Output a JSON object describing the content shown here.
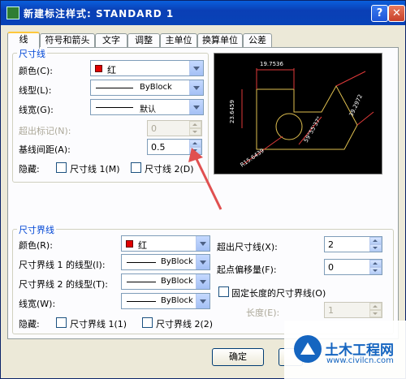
{
  "window": {
    "title": "新建标注样式: STANDARD 1",
    "help": "?",
    "close": "✕"
  },
  "tabs": [
    "线",
    "符号和箭头",
    "文字",
    "调整",
    "主单位",
    "换算单位",
    "公差"
  ],
  "dim_lines": {
    "group_title": "尺寸线",
    "color_label": "颜色(C):",
    "color_value": "红",
    "linetype_label": "线型(L):",
    "linetype_value": "ByBlock",
    "lineweight_label": "线宽(G):",
    "lineweight_value": "默认",
    "extend_label": "超出标记(N):",
    "extend_value": "0",
    "baseline_label": "基线间距(A):",
    "baseline_value": "0.5",
    "suppress_label": "隐藏:",
    "suppress_1": "尺寸线 1(M)",
    "suppress_2": "尺寸线 2(D)"
  },
  "preview": {
    "dims": [
      "19.7536",
      "23.6459",
      "39.2972",
      "59°55'37\"",
      "R15.6439"
    ]
  },
  "ext_lines": {
    "group_title": "尺寸界线",
    "color_label": "颜色(R):",
    "color_value": "红",
    "lt1_label": "尺寸界线 1 的线型(I):",
    "lt1_value": "ByBlock",
    "lt2_label": "尺寸界线 2 的线型(T):",
    "lt2_value": "ByBlock",
    "lw_label": "线宽(W):",
    "lw_value": "ByBlock",
    "suppress_label": "隐藏:",
    "suppress_1": "尺寸界线 1(1)",
    "suppress_2": "尺寸界线 2(2)",
    "beyond_label": "超出尺寸线(X):",
    "beyond_value": "2",
    "offset_label": "起点偏移量(F):",
    "offset_value": "0",
    "fixed_label": "固定长度的尺寸界线(O)",
    "length_label": "长度(E):",
    "length_value": "1"
  },
  "buttons": {
    "ok": "确定"
  },
  "watermark": {
    "title": "土木工程网",
    "url": "www.civilcn.com"
  },
  "colors": {
    "title_bar": "#0a46c8",
    "group_title": "#0046d5",
    "annotation_arrow": "#e05050",
    "preview_line": "#e0c050"
  }
}
